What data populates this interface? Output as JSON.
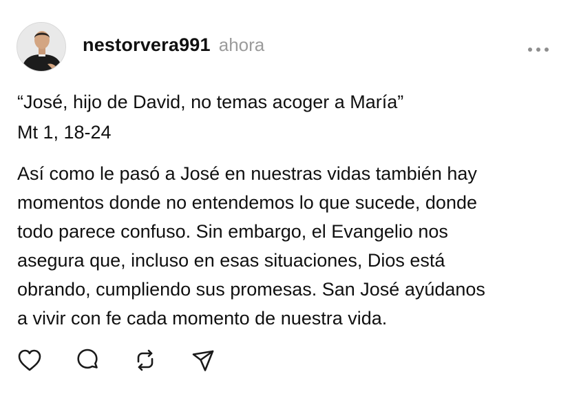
{
  "post": {
    "username": "nestorvera991",
    "time": "ahora",
    "quote": "“José, hijo de David, no temas acoger a María”",
    "reference": "Mt 1, 18-24",
    "body_lines": [
      "Así como le pasó a José en nuestras vidas también hay",
      "momentos donde no entendemos lo que sucede, donde",
      "todo parece confuso. Sin embargo, el Evangelio nos",
      "asegura que, incluso en esas situaciones, Dios está",
      "obrando, cumpliendo sus promesas. San José ayúdanos",
      "a vivir con fe cada momento de nuestra vida."
    ]
  },
  "icons": {
    "more": "more-horizontal-icon",
    "like": "heart-icon",
    "reply": "comment-icon",
    "repost": "repost-icon",
    "share": "send-icon"
  },
  "colors": {
    "text": "#101010",
    "muted": "#9b9b9b",
    "icon": "#1a1a1a"
  }
}
